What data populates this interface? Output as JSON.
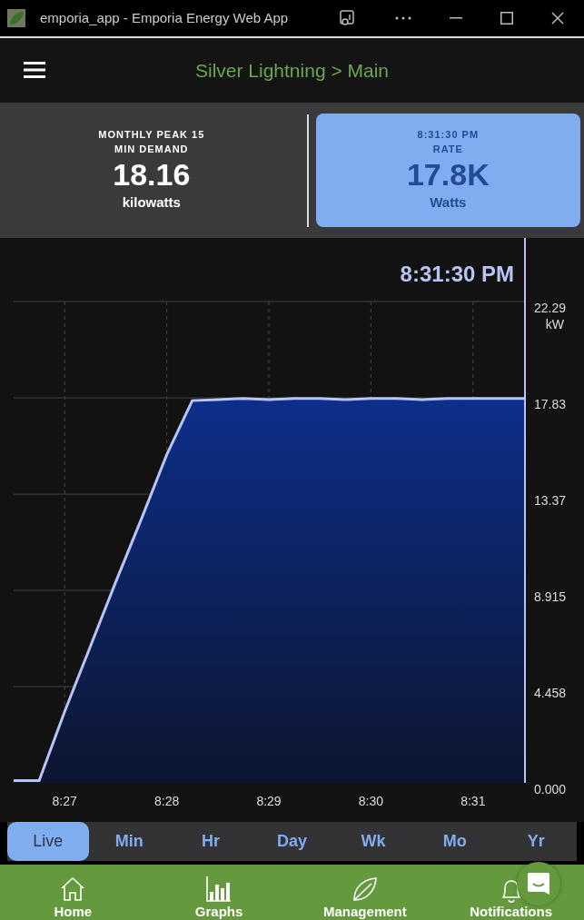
{
  "window": {
    "title": "emporia_app - Emporia Energy Web App"
  },
  "header": {
    "title": "Silver Lightning > Main"
  },
  "stats": [
    {
      "label": "MONTHLY PEAK 15 MIN DEMAND",
      "value": "18.16",
      "unit": "kilowatts",
      "selected": false
    },
    {
      "caption": "8:31:30 PM",
      "label": "RATE",
      "value": "17.8K",
      "unit": "Watts",
      "selected": true
    }
  ],
  "chart": {
    "time_label": "8:31:30 PM",
    "unit_label": "kW",
    "chart_data": {
      "type": "area",
      "categories": [
        null,
        null,
        "8:27",
        null,
        null,
        null,
        "8:28",
        null,
        null,
        null,
        "8:29",
        null,
        null,
        null,
        "8:30",
        null,
        null,
        null,
        "8:31",
        null,
        null
      ],
      "series": [
        {
          "color": "#b7c4f5",
          "values": [
            0.1,
            0.1,
            3.3,
            6.3,
            9.3,
            12.2,
            15.2,
            17.7,
            17.75,
            17.8,
            17.75,
            17.8,
            17.8,
            17.75,
            17.8,
            17.8,
            17.75,
            17.8,
            17.8,
            17.8,
            17.8
          ]
        }
      ],
      "ylim": [
        0,
        22.29
      ],
      "grid": true,
      "yticks": [
        {
          "value": 0,
          "label": "0.000"
        },
        {
          "value": 4.458,
          "label": "4.458"
        },
        {
          "value": 8.915,
          "label": "8.915"
        },
        {
          "value": 13.37,
          "label": "13.37"
        },
        {
          "value": 17.83,
          "label": "17.83"
        },
        {
          "value": 22.29,
          "label": "22.29"
        }
      ]
    }
  },
  "ranges": [
    {
      "label": "Live",
      "selected": true
    },
    {
      "label": "Min",
      "selected": false
    },
    {
      "label": "Hr",
      "selected": false
    },
    {
      "label": "Day",
      "selected": false
    },
    {
      "label": "Wk",
      "selected": false
    },
    {
      "label": "Mo",
      "selected": false
    },
    {
      "label": "Yr",
      "selected": false
    }
  ],
  "nav": [
    {
      "kind": "home",
      "label": "Home"
    },
    {
      "kind": "graphs",
      "label": "Graphs"
    },
    {
      "kind": "leaf",
      "label": "Management"
    },
    {
      "kind": "bell",
      "label": "Notifications"
    }
  ]
}
